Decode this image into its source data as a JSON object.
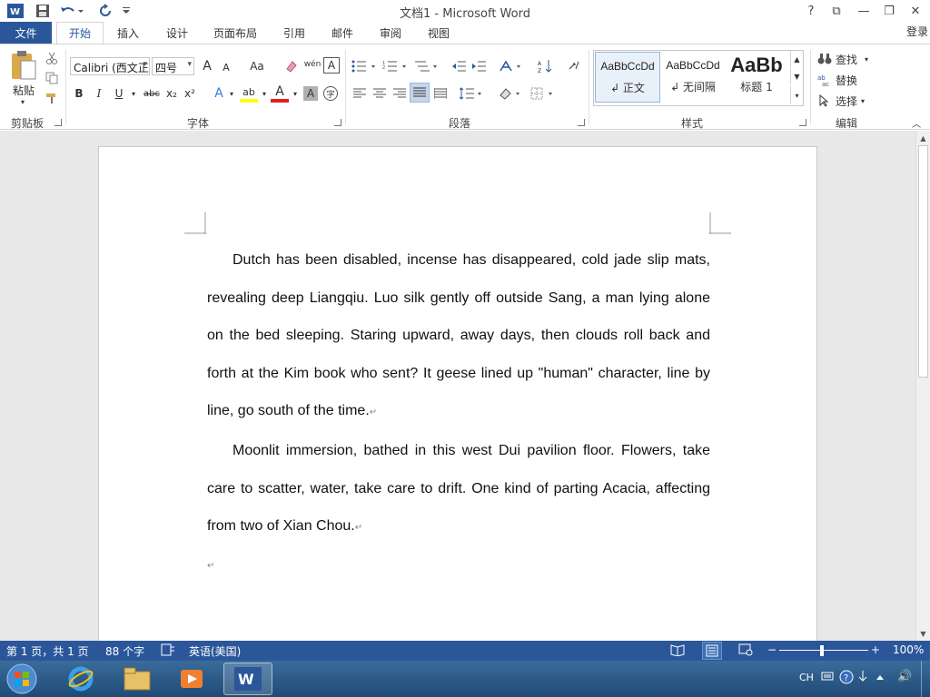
{
  "title_bar": {
    "title": "文档1 - Microsoft Word",
    "help": "?",
    "ribbon_display": "⧉",
    "minimize": "—",
    "restore": "❐",
    "close": "✕"
  },
  "tabs": {
    "file": "文件",
    "items": [
      "开始",
      "插入",
      "设计",
      "页面布局",
      "引用",
      "邮件",
      "审阅",
      "视图"
    ],
    "active": "开始",
    "login": "登录"
  },
  "ribbon": {
    "clipboard": {
      "paste": "粘贴",
      "label": "剪贴板"
    },
    "font": {
      "font_name": "Calibri (西文正文)",
      "font_size": "四号",
      "grow": "A",
      "shrink": "A",
      "change_case": "Aa",
      "phonetic": "wén",
      "border_char": "A",
      "bold": "B",
      "italic": "I",
      "underline": "U",
      "strike": "abc",
      "subscript": "x₂",
      "superscript": "x²",
      "text_effects": "A",
      "highlight": "ab",
      "font_color": "A",
      "char_shading": "A",
      "enclose": "字",
      "label": "字体"
    },
    "paragraph": {
      "label": "段落"
    },
    "styles": {
      "items": [
        {
          "sample": "AaBbCcDd",
          "name": "↲ 正文"
        },
        {
          "sample": "AaBbCcDd",
          "name": "↲ 无间隔"
        },
        {
          "sample": "AaBb",
          "name": "标题 1"
        }
      ],
      "label": "样式"
    },
    "editing": {
      "find": "查找",
      "replace": "替换",
      "select": "选择",
      "label": "编辑"
    }
  },
  "document": {
    "paragraphs": [
      "Dutch has been disabled, incense has disappeared, cold jade slip mats, revealing deep Liangqiu. Luo silk gently off outside Sang, a man lying alone on the bed sleeping. Staring upward, away days, then clouds roll back and forth at the Kim book who sent? It geese lined up \"human\" character, line by line, go south of the time.",
      "Moonlit immersion, bathed in this west Dui pavilion floor. Flowers, take care to scatter, water, take care to drift. One kind of parting Acacia, affecting from two of Xian Chou."
    ],
    "para_mark": "↵"
  },
  "status_bar": {
    "page": "第 1 页，共 1 页",
    "words": "88 个字",
    "language": "英语(美国)",
    "zoom": "100%",
    "zoom_minus": "−",
    "zoom_plus": "+"
  },
  "taskbar": {
    "tray_lang": "CH",
    "tray_speaker": "🔊"
  },
  "colors": {
    "accent": "#2b579a",
    "taskbar": "#1f4a76"
  }
}
